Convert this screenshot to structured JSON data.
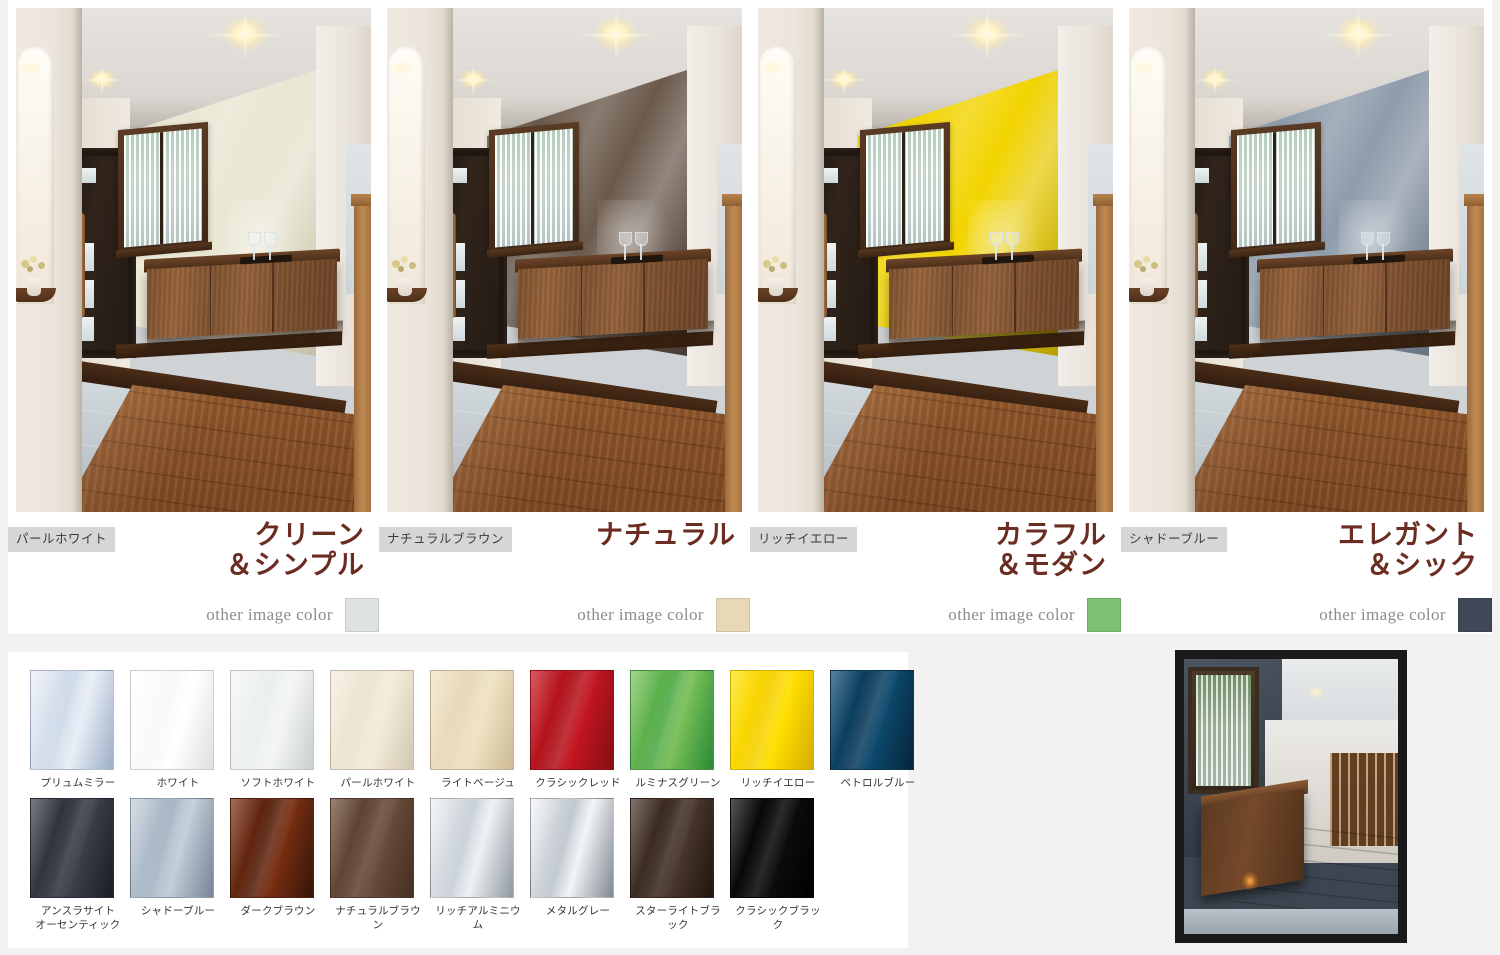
{
  "panels": [
    {
      "chip": "パールホワイト",
      "headline_line1": "クリーン",
      "headline_line2": "＆シンプル",
      "other_image_label": "other image color",
      "other_image_color": "#dde4e0",
      "accent_color": "#e9e6d2",
      "accent_color_dark": "#d8d3b9"
    },
    {
      "chip": "ナチュラルブラウン",
      "headline_line1": "ナチュラル",
      "headline_line2": "",
      "other_image_label": "other image color",
      "other_image_color": "#e8d8b8",
      "accent_color": "#6b5a4c",
      "accent_color_dark": "#4e4038"
    },
    {
      "chip": "リッチイエロー",
      "headline_line1": "カラフル",
      "headline_line2": "＆モダン",
      "other_image_label": "other image color",
      "other_image_color": "#7dc272",
      "accent_color": "#f2d400",
      "accent_color_dark": "#c9ae00"
    },
    {
      "chip": "シャドーブルー",
      "headline_line1": "エレガント",
      "headline_line2": "＆シック",
      "other_image_label": "other image color",
      "other_image_color": "#3f4857",
      "accent_color": "#8e9cab",
      "accent_color_dark": "#6f7d8d"
    }
  ],
  "swatches": [
    {
      "label": "プリュムミラー",
      "c1": "#e9eef5",
      "c2": "#a9bcd6",
      "c3": "#ccd8e8"
    },
    {
      "label": "ホワイト",
      "c1": "#ffffff",
      "c2": "#eef0f1",
      "c3": "#f7f8f9"
    },
    {
      "label": "ソフトホワイト",
      "c1": "#f4f6f5",
      "c2": "#d8dedd",
      "c3": "#e9eeec"
    },
    {
      "label": "パールホワイト",
      "c1": "#f3ecdc",
      "c2": "#e2d6bd",
      "c3": "#ece3cf"
    },
    {
      "label": "ライトベージュ",
      "c1": "#efe2c4",
      "c2": "#dcc99f",
      "c3": "#e7d7b5"
    },
    {
      "label": "クラシックレッド",
      "c1": "#c4151f",
      "c2": "#8f0f17",
      "c3": "#ae1119"
    },
    {
      "label": "ルミナスグリーン",
      "c1": "#7ac05a",
      "c2": "#2e9438",
      "c3": "#4faa46"
    },
    {
      "label": "リッチイエロー",
      "c1": "#ffe000",
      "c2": "#e8b900",
      "c3": "#f5d000"
    },
    {
      "label": "ペトロルブルー",
      "c1": "#0d4a6e",
      "c2": "#05283f",
      "c3": "#0a3a59"
    },
    {
      "label": "アンスラサイト\nオーセンティック",
      "c1": "#3b414c",
      "c2": "#1c2027",
      "c3": "#2a2f38"
    },
    {
      "label": "シャドーブルー",
      "c1": "#c2ced9",
      "c2": "#7e8fa1",
      "c3": "#a3b2c1"
    },
    {
      "label": "ダークブラウン",
      "c1": "#7a2f12",
      "c2": "#3a1608",
      "c3": "#56200c"
    },
    {
      "label": "ナチュラルブラウン",
      "c1": "#6a4c3a",
      "c2": "#4a3326",
      "c3": "#5c4030"
    },
    {
      "label": "リッチアルミニウム",
      "c1": "#eef1f3",
      "c2": "#9aa3ad",
      "c3": "#c6ced6"
    },
    {
      "label": "メタルグレー",
      "c1": "#f2f4f6",
      "c2": "#8b949d",
      "c3": "#bcc4cc"
    },
    {
      "label": "スターライトブラック",
      "c1": "#4a382e",
      "c2": "#23170f",
      "c3": "#35251a"
    },
    {
      "label": "クラシックブラック",
      "c1": "#0d0d0d",
      "c2": "#000000",
      "c3": "#050505"
    }
  ]
}
